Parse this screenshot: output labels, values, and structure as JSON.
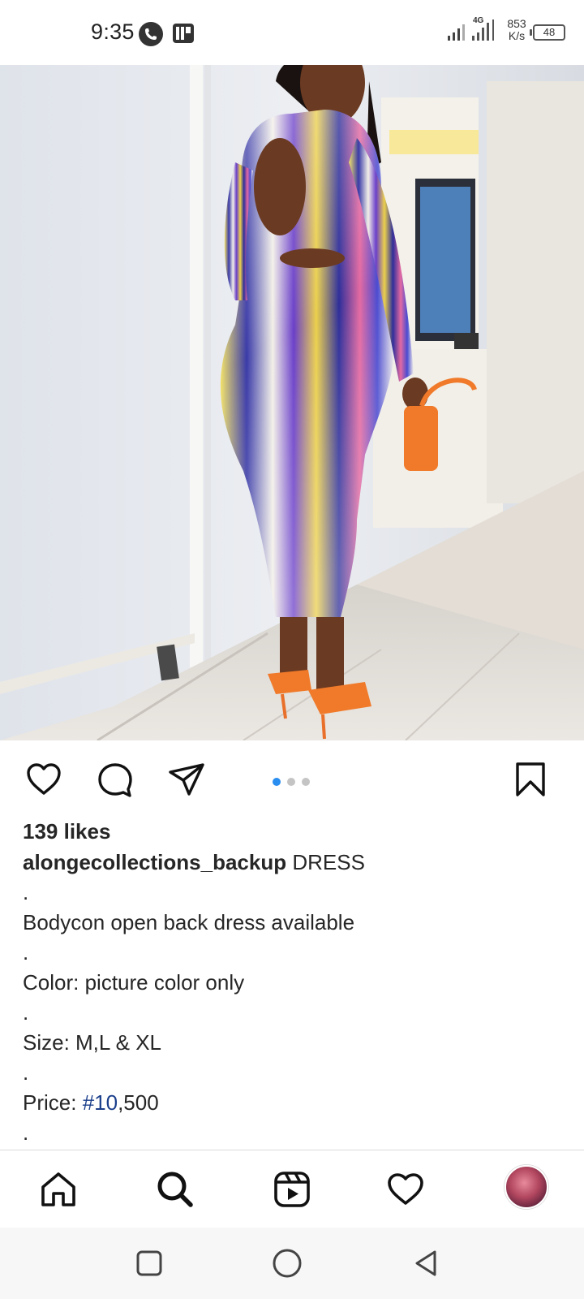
{
  "status_bar": {
    "time": "9:35",
    "network": "4G",
    "speed_value": "853",
    "speed_unit": "K/s",
    "battery": "48",
    "icons": [
      "call-icon",
      "app-notification-icon",
      "signal-icon",
      "signal-4g-icon",
      "battery-icon"
    ]
  },
  "post": {
    "image": {
      "carousel_index": 1,
      "carousel_count": 3
    },
    "actions": {
      "like_icon": "heart-outline-icon",
      "comment_icon": "comment-bubble-icon",
      "share_icon": "send-paper-plane-icon",
      "save_icon": "bookmark-outline-icon"
    },
    "likes": "139 likes",
    "username": "alongecollections_backup",
    "caption_title": "DRESS",
    "caption_lines": [
      ".",
      "Bodycon open back dress available",
      ".",
      "Color: picture color only",
      ".",
      "Size: M,L & XL",
      ".",
      "Price: ",
      "."
    ],
    "price_hashtag": "#10",
    "price_rest": ",500"
  },
  "bottom_nav": {
    "items": [
      "home-icon",
      "search-icon",
      "reels-icon",
      "activity-heart-icon",
      "profile-avatar"
    ]
  },
  "system_nav": {
    "items": [
      "recents-square-icon",
      "home-circle-icon",
      "back-triangle-icon"
    ]
  },
  "colors": {
    "accent_blue": "#2a8df0",
    "hashtag_blue": "#1b3f8b",
    "text_dark": "#262626",
    "dot_inactive": "#c4c4c4"
  }
}
